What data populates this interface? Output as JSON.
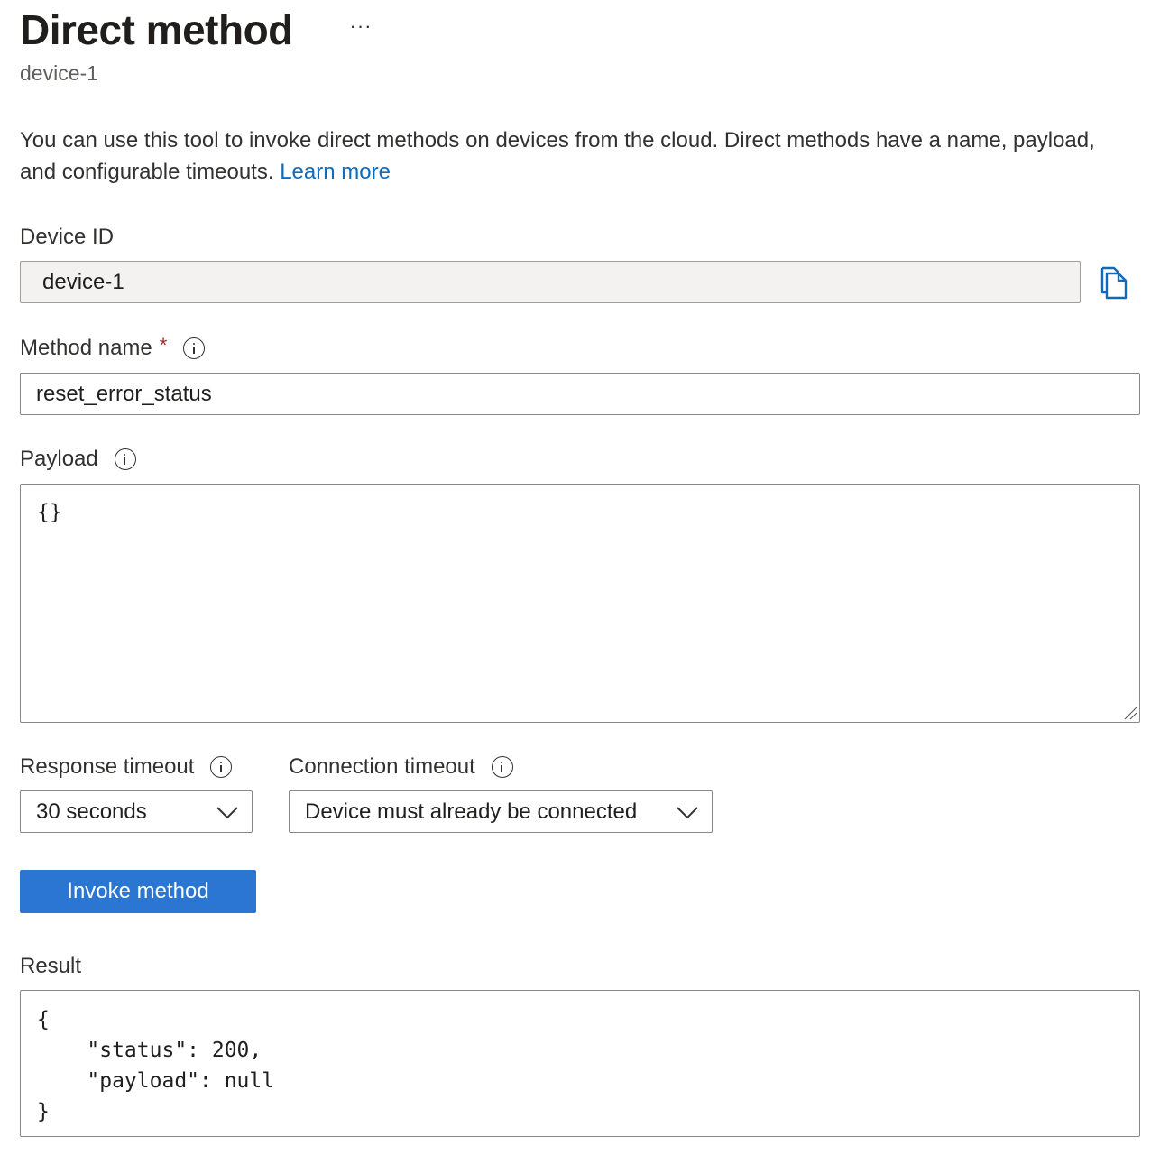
{
  "header": {
    "title": "Direct method",
    "more_label": "···",
    "subtitle": "device-1"
  },
  "description": {
    "text": "You can use this tool to invoke direct methods on devices from the cloud. Direct methods have a name, payload, and configurable timeouts. ",
    "link_label": "Learn more"
  },
  "device_id": {
    "label": "Device ID",
    "value": "device-1",
    "copy_icon": "copy-icon"
  },
  "method_name": {
    "label": "Method name",
    "required_mark": "*",
    "value": "reset_error_status",
    "info_icon": "info-icon"
  },
  "payload": {
    "label": "Payload",
    "value": "{}",
    "info_icon": "info-icon"
  },
  "response_timeout": {
    "label": "Response timeout",
    "selected": "30 seconds",
    "info_icon": "info-icon"
  },
  "connection_timeout": {
    "label": "Connection timeout",
    "selected": "Device must already be connected",
    "info_icon": "info-icon"
  },
  "invoke_button": {
    "label": "Invoke method"
  },
  "result": {
    "label": "Result",
    "lines": [
      "{",
      "    \"status\": 200,",
      "    \"payload\": null",
      "}"
    ]
  },
  "colors": {
    "accent": "#2b76d2",
    "link": "#0f6cbd",
    "required": "#a4262c",
    "border": "#8a8886",
    "disabled_bg": "#f3f2f1"
  }
}
